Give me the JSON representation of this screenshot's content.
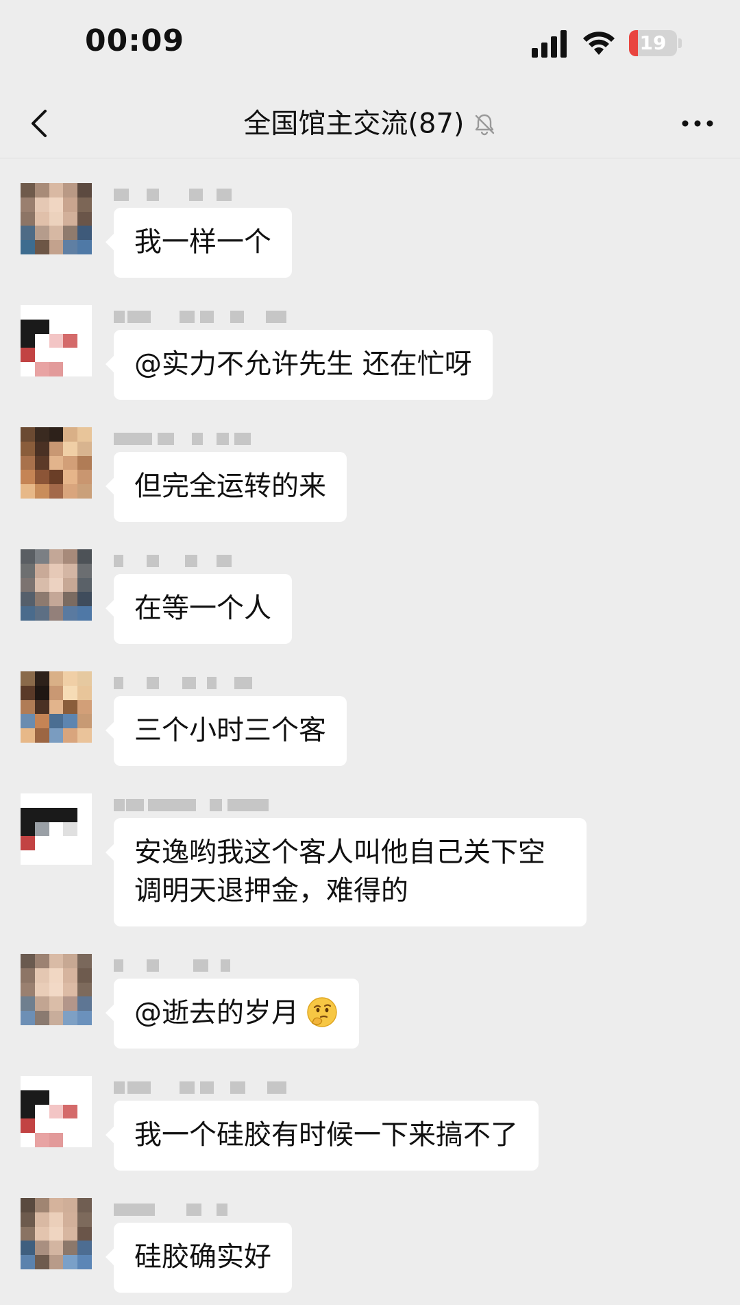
{
  "status_bar": {
    "time": "00:09",
    "battery": "19",
    "battery_level": 0.19
  },
  "nav": {
    "title": "全国馆主交流(87)"
  },
  "messages": [
    {
      "text": "我一样一个"
    },
    {
      "text": "@实力不允许先生 还在忙呀"
    },
    {
      "text": "但完全运转的来"
    },
    {
      "text": "在等一个人"
    },
    {
      "text": "三个小时三个客"
    },
    {
      "text": "安逸哟我这个客人叫他自己关下空调明天退押金，难得的"
    },
    {
      "text": "@逝去的岁月",
      "emoji": "thinking-face-icon"
    },
    {
      "text": "我一个硅胶有时候一下来搞不了"
    },
    {
      "text": "硅胶确实好"
    }
  ],
  "colors": {
    "background": "#ededed",
    "bubble": "#ffffff",
    "battery_low": "#e9453f"
  }
}
